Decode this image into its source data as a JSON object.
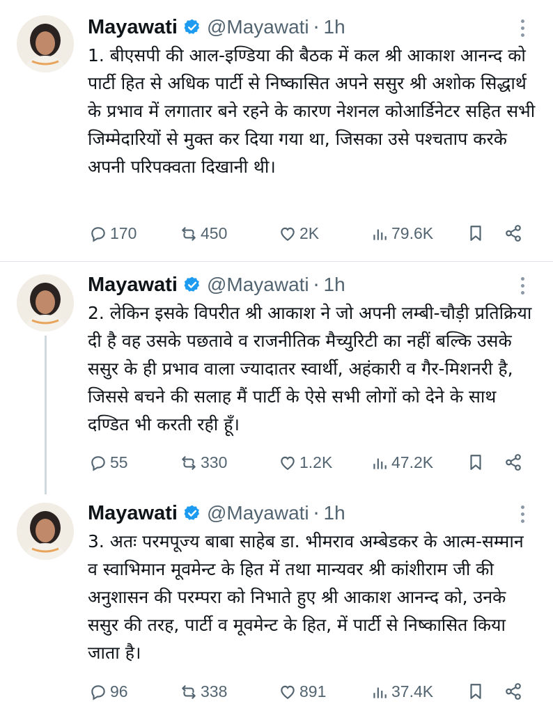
{
  "tweets": [
    {
      "name": "Mayawati",
      "handle": "@Mayawati",
      "dot": "·",
      "time": "1h",
      "text": "1. बीएसपी की आल-इण्डिया की बैठक में कल श्री आकाश आनन्द को पार्टी हित से अधिक पार्टी से निष्कासित अपने ससुर श्री अशोक सिद्धार्थ के प्रभाव में लगातार बने रहने के कारण नेशनल कोआर्डिनेटर सहित सभी जिम्मेदारियों से मुक्त कर दिया गया था, जिसका उसे पश्चताप करके अपनी परिपक्वता दिखानी थी।",
      "replies": "170",
      "reposts": "450",
      "likes": "2K",
      "views": "79.6K"
    },
    {
      "name": "Mayawati",
      "handle": "@Mayawati",
      "dot": "·",
      "time": "1h",
      "text": "2. लेकिन इसके विपरीत श्री आकाश ने जो अपनी लम्बी-चौड़ी प्रतिक्रिया दी है वह उसके पछतावे व राजनीतिक मैच्युरिटी का नहीं बल्कि उसके ससुर के ही प्रभाव वाला ज्यादातर स्वार्थी, अहंकारी व गैर-मिशनरी है, जिससे बचने की सलाह मैं पार्टी के ऐसे सभी लोगों को देने के साथ दण्डित भी करती रही हूँ।",
      "replies": "55",
      "reposts": "330",
      "likes": "1.2K",
      "views": "47.2K"
    },
    {
      "name": "Mayawati",
      "handle": "@Mayawati",
      "dot": "·",
      "time": "1h",
      "text": "3. अतः परमपूज्य बाबा साहेब डा. भीमराव अम्बेडकर के आत्म-सम्मान व स्वाभिमान मूवमेन्ट के हित में तथा मान्यवर श्री कांशीराम जी की अनुशासन की परम्परा को निभाते हुए श्री आकाश आनन्द को, उनके ससुर की तरह, पार्टी व मूवमेन्ट के हित, में पार्टी से निष्कासित किया जाता है।",
      "replies": "96",
      "reposts": "338",
      "likes": "891",
      "views": "37.4K"
    }
  ],
  "icons": {
    "verified": "verified-badge-icon",
    "more": "more-options-icon",
    "reply": "reply-icon",
    "repost": "repost-icon",
    "like": "like-icon",
    "views": "views-icon",
    "bookmark": "bookmark-icon",
    "share": "share-icon"
  },
  "colors": {
    "verified": "#1d9bf0",
    "muted": "#536471",
    "text": "#0f1419"
  }
}
